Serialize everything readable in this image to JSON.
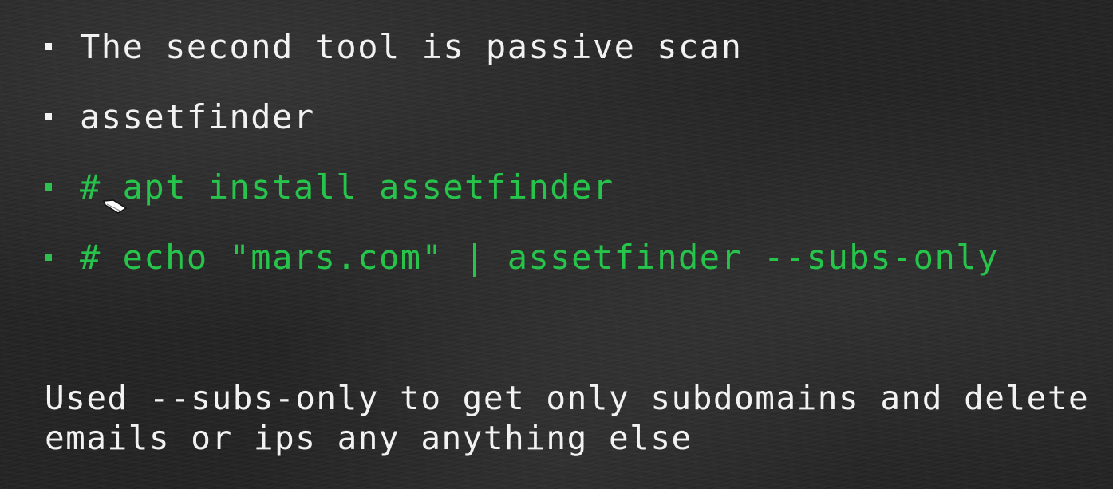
{
  "slide": {
    "bullets": [
      {
        "text": "The second tool is passive scan",
        "color": "#f2f2f2"
      },
      {
        "text": "assetfinder",
        "color": "#f2f2f2"
      },
      {
        "text": "# apt install assetfinder",
        "color": "#27c44c"
      },
      {
        "text": "# echo \"mars.com\" | assetfinder --subs-only",
        "color": "#27c44c"
      }
    ],
    "note": "Used --subs-only to get only subdomains and delete\nemails or ips any anything else"
  },
  "pointer": {
    "icon": "mouse-cursor-icon"
  }
}
